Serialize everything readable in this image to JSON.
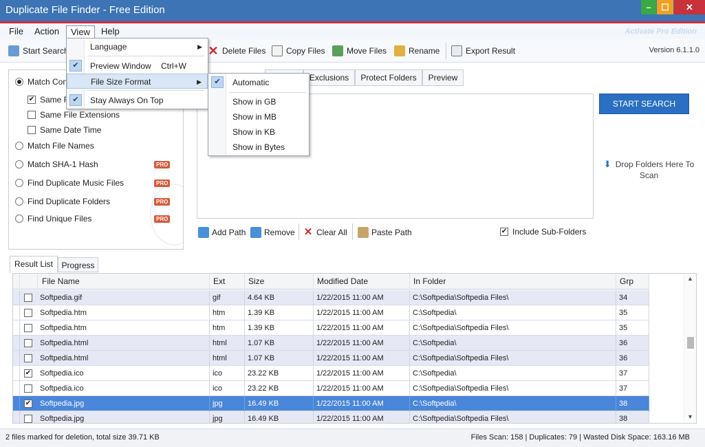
{
  "window": {
    "title": "Duplicate File Finder - Free Edition",
    "minimize_glyph": "–",
    "maximize_glyph": "☐",
    "close_glyph": "✕"
  },
  "menubar": {
    "items": [
      "File",
      "Action",
      "View",
      "Help"
    ],
    "activate_label": "Activate Pro Edition"
  },
  "view_menu": {
    "items": [
      {
        "label": "Language",
        "checked": false,
        "shortcut": "",
        "submenu": true
      },
      {
        "label": "Preview Window",
        "checked": true,
        "shortcut": "Ctrl+W",
        "submenu": false
      },
      {
        "label": "File Size Format",
        "checked": false,
        "shortcut": "",
        "submenu": true
      },
      {
        "label": "Stay Always On Top",
        "checked": true,
        "shortcut": "",
        "submenu": false
      }
    ]
  },
  "size_submenu": {
    "items": [
      {
        "label": "Automatic",
        "checked": true
      },
      {
        "label": "Show in GB",
        "checked": false
      },
      {
        "label": "Show in MB",
        "checked": false
      },
      {
        "label": "Show in KB",
        "checked": false
      },
      {
        "label": "Show in Bytes",
        "checked": false
      }
    ]
  },
  "toolbar": {
    "start_search": "Start Search",
    "delete_files": "Delete Files",
    "copy_files": "Copy Files",
    "move_files": "Move Files",
    "rename": "Rename",
    "export_result": "Export Result",
    "version": "Version 6.1.1.0"
  },
  "search_options": {
    "match_content": "Match Content",
    "same_file_size": "Same File Size",
    "same_file_extensions": "Same File Extensions",
    "same_date_time": "Same Date Time",
    "match_file_names": "Match File Names",
    "match_sha1": "Match SHA-1 Hash",
    "find_duplicate_music": "Find Duplicate Music Files",
    "find_duplicate_folders": "Find Duplicate Folders",
    "find_unique_files": "Find Unique Files",
    "pro_badge": "PRO"
  },
  "tabs": {
    "exclusions": "Exclusions",
    "protect_folders": "Protect Folders",
    "preview": "Preview"
  },
  "search_panel": {
    "start_search_button": "START SEARCH",
    "drop_hint": "Drop Folders Here To Scan",
    "add_path": "Add Path",
    "remove": "Remove",
    "clear_all": "Clear All",
    "paste_path": "Paste Path",
    "include_subfolders": "Include Sub-Folders"
  },
  "result_tabs": {
    "result_list": "Result List",
    "progress": "Progress"
  },
  "table": {
    "columns": [
      "File Name",
      "Ext",
      "Size",
      "Modified Date",
      "In Folder",
      "Grp"
    ],
    "rows": [
      {
        "checked": false,
        "name": "Softpedia.gif",
        "ext": "gif",
        "size": "4.64 KB",
        "date": "1/22/2015 11:00 AM",
        "folder": "C:\\Softpedia\\Softpedia Files\\",
        "grp": "34",
        "style": "alt"
      },
      {
        "checked": false,
        "name": "Softpedia.htm",
        "ext": "htm",
        "size": "1.39 KB",
        "date": "1/22/2015 11:00 AM",
        "folder": "C:\\Softpedia\\",
        "grp": "35",
        "style": ""
      },
      {
        "checked": false,
        "name": "Softpedia.htm",
        "ext": "htm",
        "size": "1.39 KB",
        "date": "1/22/2015 11:00 AM",
        "folder": "C:\\Softpedia\\Softpedia Files\\",
        "grp": "35",
        "style": ""
      },
      {
        "checked": false,
        "name": "Softpedia.html",
        "ext": "html",
        "size": "1.07 KB",
        "date": "1/22/2015 11:00 AM",
        "folder": "C:\\Softpedia\\",
        "grp": "36",
        "style": "alt"
      },
      {
        "checked": false,
        "name": "Softpedia.html",
        "ext": "html",
        "size": "1.07 KB",
        "date": "1/22/2015 11:00 AM",
        "folder": "C:\\Softpedia\\Softpedia Files\\",
        "grp": "36",
        "style": "alt"
      },
      {
        "checked": true,
        "name": "Softpedia.ico",
        "ext": "ico",
        "size": "23.22 KB",
        "date": "1/22/2015 11:00 AM",
        "folder": "C:\\Softpedia\\",
        "grp": "37",
        "style": ""
      },
      {
        "checked": false,
        "name": "Softpedia.ico",
        "ext": "ico",
        "size": "23.22 KB",
        "date": "1/22/2015 11:00 AM",
        "folder": "C:\\Softpedia\\Softpedia Files\\",
        "grp": "37",
        "style": ""
      },
      {
        "checked": true,
        "name": "Softpedia.jpg",
        "ext": "jpg",
        "size": "16.49 KB",
        "date": "1/22/2015 11:00 AM",
        "folder": "C:\\Softpedia\\",
        "grp": "38",
        "style": "sel"
      },
      {
        "checked": false,
        "name": "Softpedia.jpg",
        "ext": "jpg",
        "size": "16.49 KB",
        "date": "1/22/2015 11:00 AM",
        "folder": "C:\\Softpedia\\Softpedia Files\\",
        "grp": "38",
        "style": "alt"
      }
    ]
  },
  "statusbar": {
    "left": "2 files marked for deletion, total size 39.71 KB",
    "right": "Files Scan: 158 | Duplicates: 79 | Wasted Disk Space: 163.16 MB"
  },
  "colors": {
    "titlebar": "#3c74b5",
    "accent_red": "#d72a3e",
    "selected_row": "#4a86d9",
    "alt_row": "#e6e8f6",
    "start_button": "#2a6fc2"
  }
}
